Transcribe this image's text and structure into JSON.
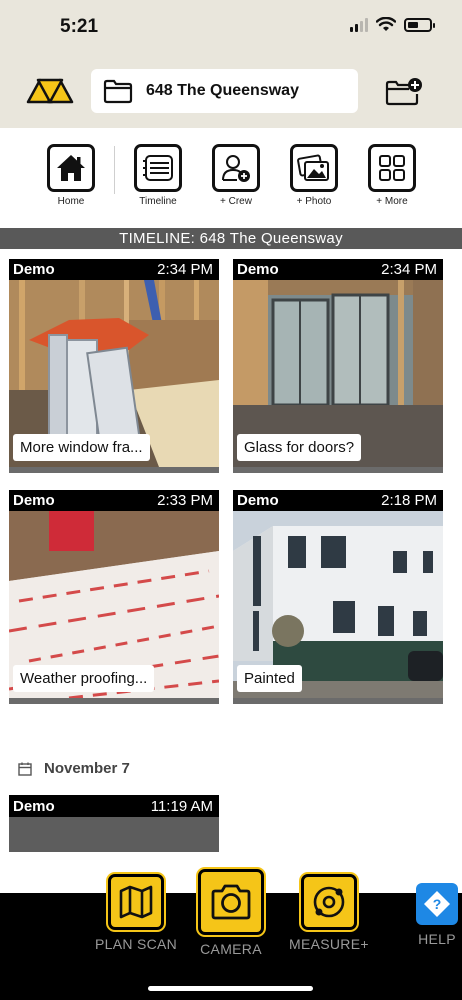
{
  "status": {
    "time": "5:21"
  },
  "header": {
    "project_name": "648 The Queensway",
    "logo_icon": "triangles-logo-icon",
    "folder_icon": "folder-icon",
    "add_folder_icon": "folder-plus-icon"
  },
  "toolbar": {
    "items": [
      {
        "label": "Home",
        "icon": "home-icon"
      },
      {
        "label": "Timeline",
        "icon": "timeline-icon"
      },
      {
        "label": "+ Crew",
        "icon": "add-user-icon"
      },
      {
        "label": "+ Photo",
        "icon": "photos-icon"
      },
      {
        "label": "+ More",
        "icon": "grid-icon"
      }
    ]
  },
  "timeline": {
    "banner": "TIMELINE: 648 The Queensway",
    "cards": [
      {
        "user": "Demo",
        "time": "2:34 PM",
        "caption": "More window fra..."
      },
      {
        "user": "Demo",
        "time": "2:34 PM",
        "caption": "Glass for doors?"
      },
      {
        "user": "Demo",
        "time": "2:33 PM",
        "caption": "Weather proofing..."
      },
      {
        "user": "Demo",
        "time": "2:18 PM",
        "caption": "Painted"
      }
    ],
    "date_header": "November 7",
    "next_card": {
      "user": "Demo",
      "time": "11:19 AM"
    }
  },
  "bottom_nav": {
    "plan_scan": "PLAN SCAN",
    "camera": "CAMERA",
    "measure": "MEASURE+",
    "help": "HELP"
  },
  "colors": {
    "accent": "#f5c518",
    "help_blue": "#1e88e5",
    "header_bg": "#e9e6dc",
    "banner_bg": "#595959"
  }
}
